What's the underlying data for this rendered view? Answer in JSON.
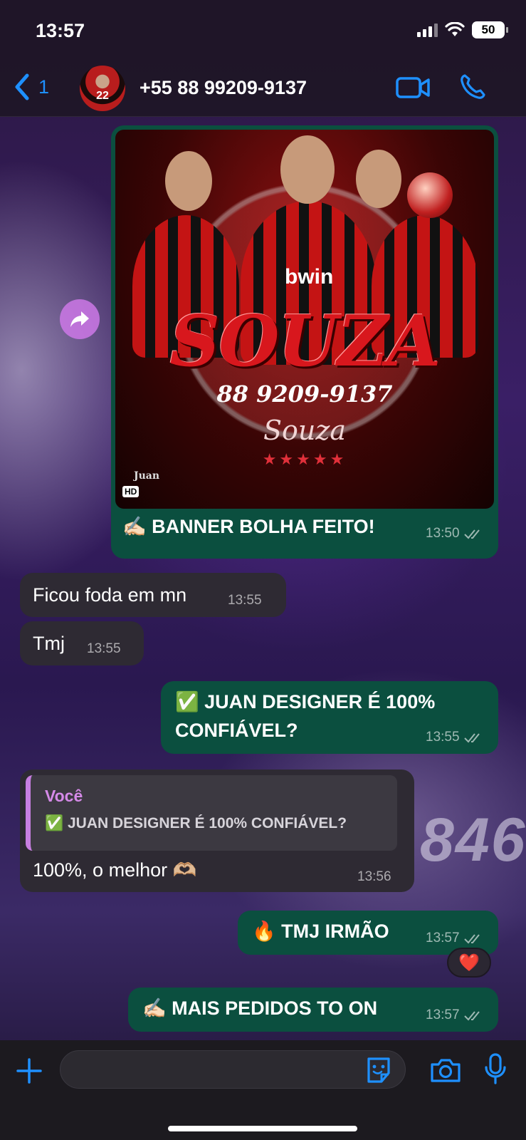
{
  "status_bar": {
    "time": "13:57",
    "battery": "50"
  },
  "header": {
    "back_count": "1",
    "avatar_text": "22",
    "contact_name": "+55 88 99209-9137"
  },
  "messages": [
    {
      "id": "banner-message",
      "direction": "outgoing",
      "image": {
        "title": "SOUZA",
        "phone": "88 9209-9137",
        "signature": "Souza",
        "stars": "★★★★★",
        "brand": "bwin",
        "watermark": "Juan",
        "badge": "HD"
      },
      "text": "✍🏻 BANNER BOLHA FEITO!",
      "time": "13:50"
    },
    {
      "id": "ficou",
      "direction": "incoming",
      "text": "Ficou foda em mn",
      "time": "13:55"
    },
    {
      "id": "tmj",
      "direction": "incoming",
      "text": "Tmj",
      "time": "13:55"
    },
    {
      "id": "confiavel",
      "direction": "outgoing",
      "text_line1": "✅ JUAN DESIGNER É 100%",
      "text_line2": "CONFIÁVEL?",
      "time": "13:55"
    },
    {
      "id": "reply",
      "direction": "incoming",
      "quote": {
        "author": "Você",
        "text": "✅ JUAN DESIGNER É 100% CONFIÁVEL?"
      },
      "text": "100%, o melhor 🫶🏼",
      "time": "13:56"
    },
    {
      "id": "tmj-irmao",
      "direction": "outgoing",
      "text": "🔥 TMJ IRMÃO",
      "time": "13:57",
      "reaction": "❤️"
    },
    {
      "id": "mais-pedidos",
      "direction": "outgoing",
      "text": "✍🏻 MAIS PEDIDOS TO ON",
      "time": "13:57"
    }
  ],
  "composer": {
    "placeholder": ""
  },
  "colors": {
    "accent": "#1e90ff",
    "outgoing_bubble": "#0b4f3f",
    "incoming_bubble": "#2e2a33",
    "quote_accent": "#c77fe0"
  },
  "icons": [
    "back-chevron-icon",
    "video-call-icon",
    "phone-icon",
    "forward-icon",
    "plus-icon",
    "sticker-icon",
    "camera-icon",
    "mic-icon",
    "double-check-icon"
  ]
}
